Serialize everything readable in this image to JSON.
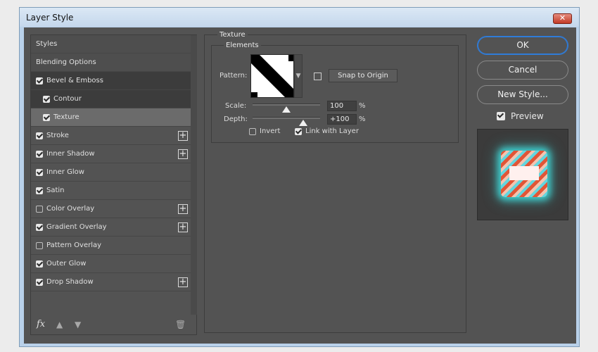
{
  "window": {
    "title": "Layer Style",
    "close_label": "✕"
  },
  "styles_list": [
    {
      "label": "Styles",
      "kind": "header"
    },
    {
      "label": "Blending Options",
      "kind": "header"
    },
    {
      "label": "Bevel & Emboss",
      "checked": true,
      "has_add": false
    },
    {
      "label": "Contour",
      "checked": true,
      "indent": true,
      "has_add": false
    },
    {
      "label": "Texture",
      "checked": true,
      "indent": true,
      "selected": true,
      "has_add": false
    },
    {
      "label": "Stroke",
      "checked": true,
      "has_add": true
    },
    {
      "label": "Inner Shadow",
      "checked": true,
      "has_add": true
    },
    {
      "label": "Inner Glow",
      "checked": true,
      "has_add": false
    },
    {
      "label": "Satin",
      "checked": true,
      "has_add": false
    },
    {
      "label": "Color Overlay",
      "checked": false,
      "has_add": true
    },
    {
      "label": "Gradient Overlay",
      "checked": true,
      "has_add": true
    },
    {
      "label": "Pattern Overlay",
      "checked": false,
      "has_add": false
    },
    {
      "label": "Outer Glow",
      "checked": true,
      "has_add": false
    },
    {
      "label": "Drop Shadow",
      "checked": true,
      "has_add": true
    }
  ],
  "bottom_bar": {
    "fx_label": "fx",
    "up_icon": "arrow-up-icon",
    "down_icon": "arrow-down-icon",
    "trash_icon": "trash-icon"
  },
  "texture": {
    "section_title": "Texture",
    "group_title": "Elements",
    "pattern_label": "Pattern:",
    "snap_button": "Snap to Origin",
    "scale_label": "Scale:",
    "scale_value": "100",
    "scale_unit": "%",
    "scale_level": 0.5,
    "depth_label": "Depth:",
    "depth_value": "+100",
    "depth_unit": "%",
    "depth_level": 0.75,
    "invert_label": "Invert",
    "invert_checked": false,
    "link_label": "Link with Layer",
    "link_checked": true
  },
  "buttons": {
    "ok": "OK",
    "cancel": "Cancel",
    "new_style": "New Style..."
  },
  "preview": {
    "label": "Preview",
    "checked": true
  },
  "colors": {
    "accent": "#2f7cd9",
    "panel": "#535353",
    "glow": "#3fd5d5"
  }
}
